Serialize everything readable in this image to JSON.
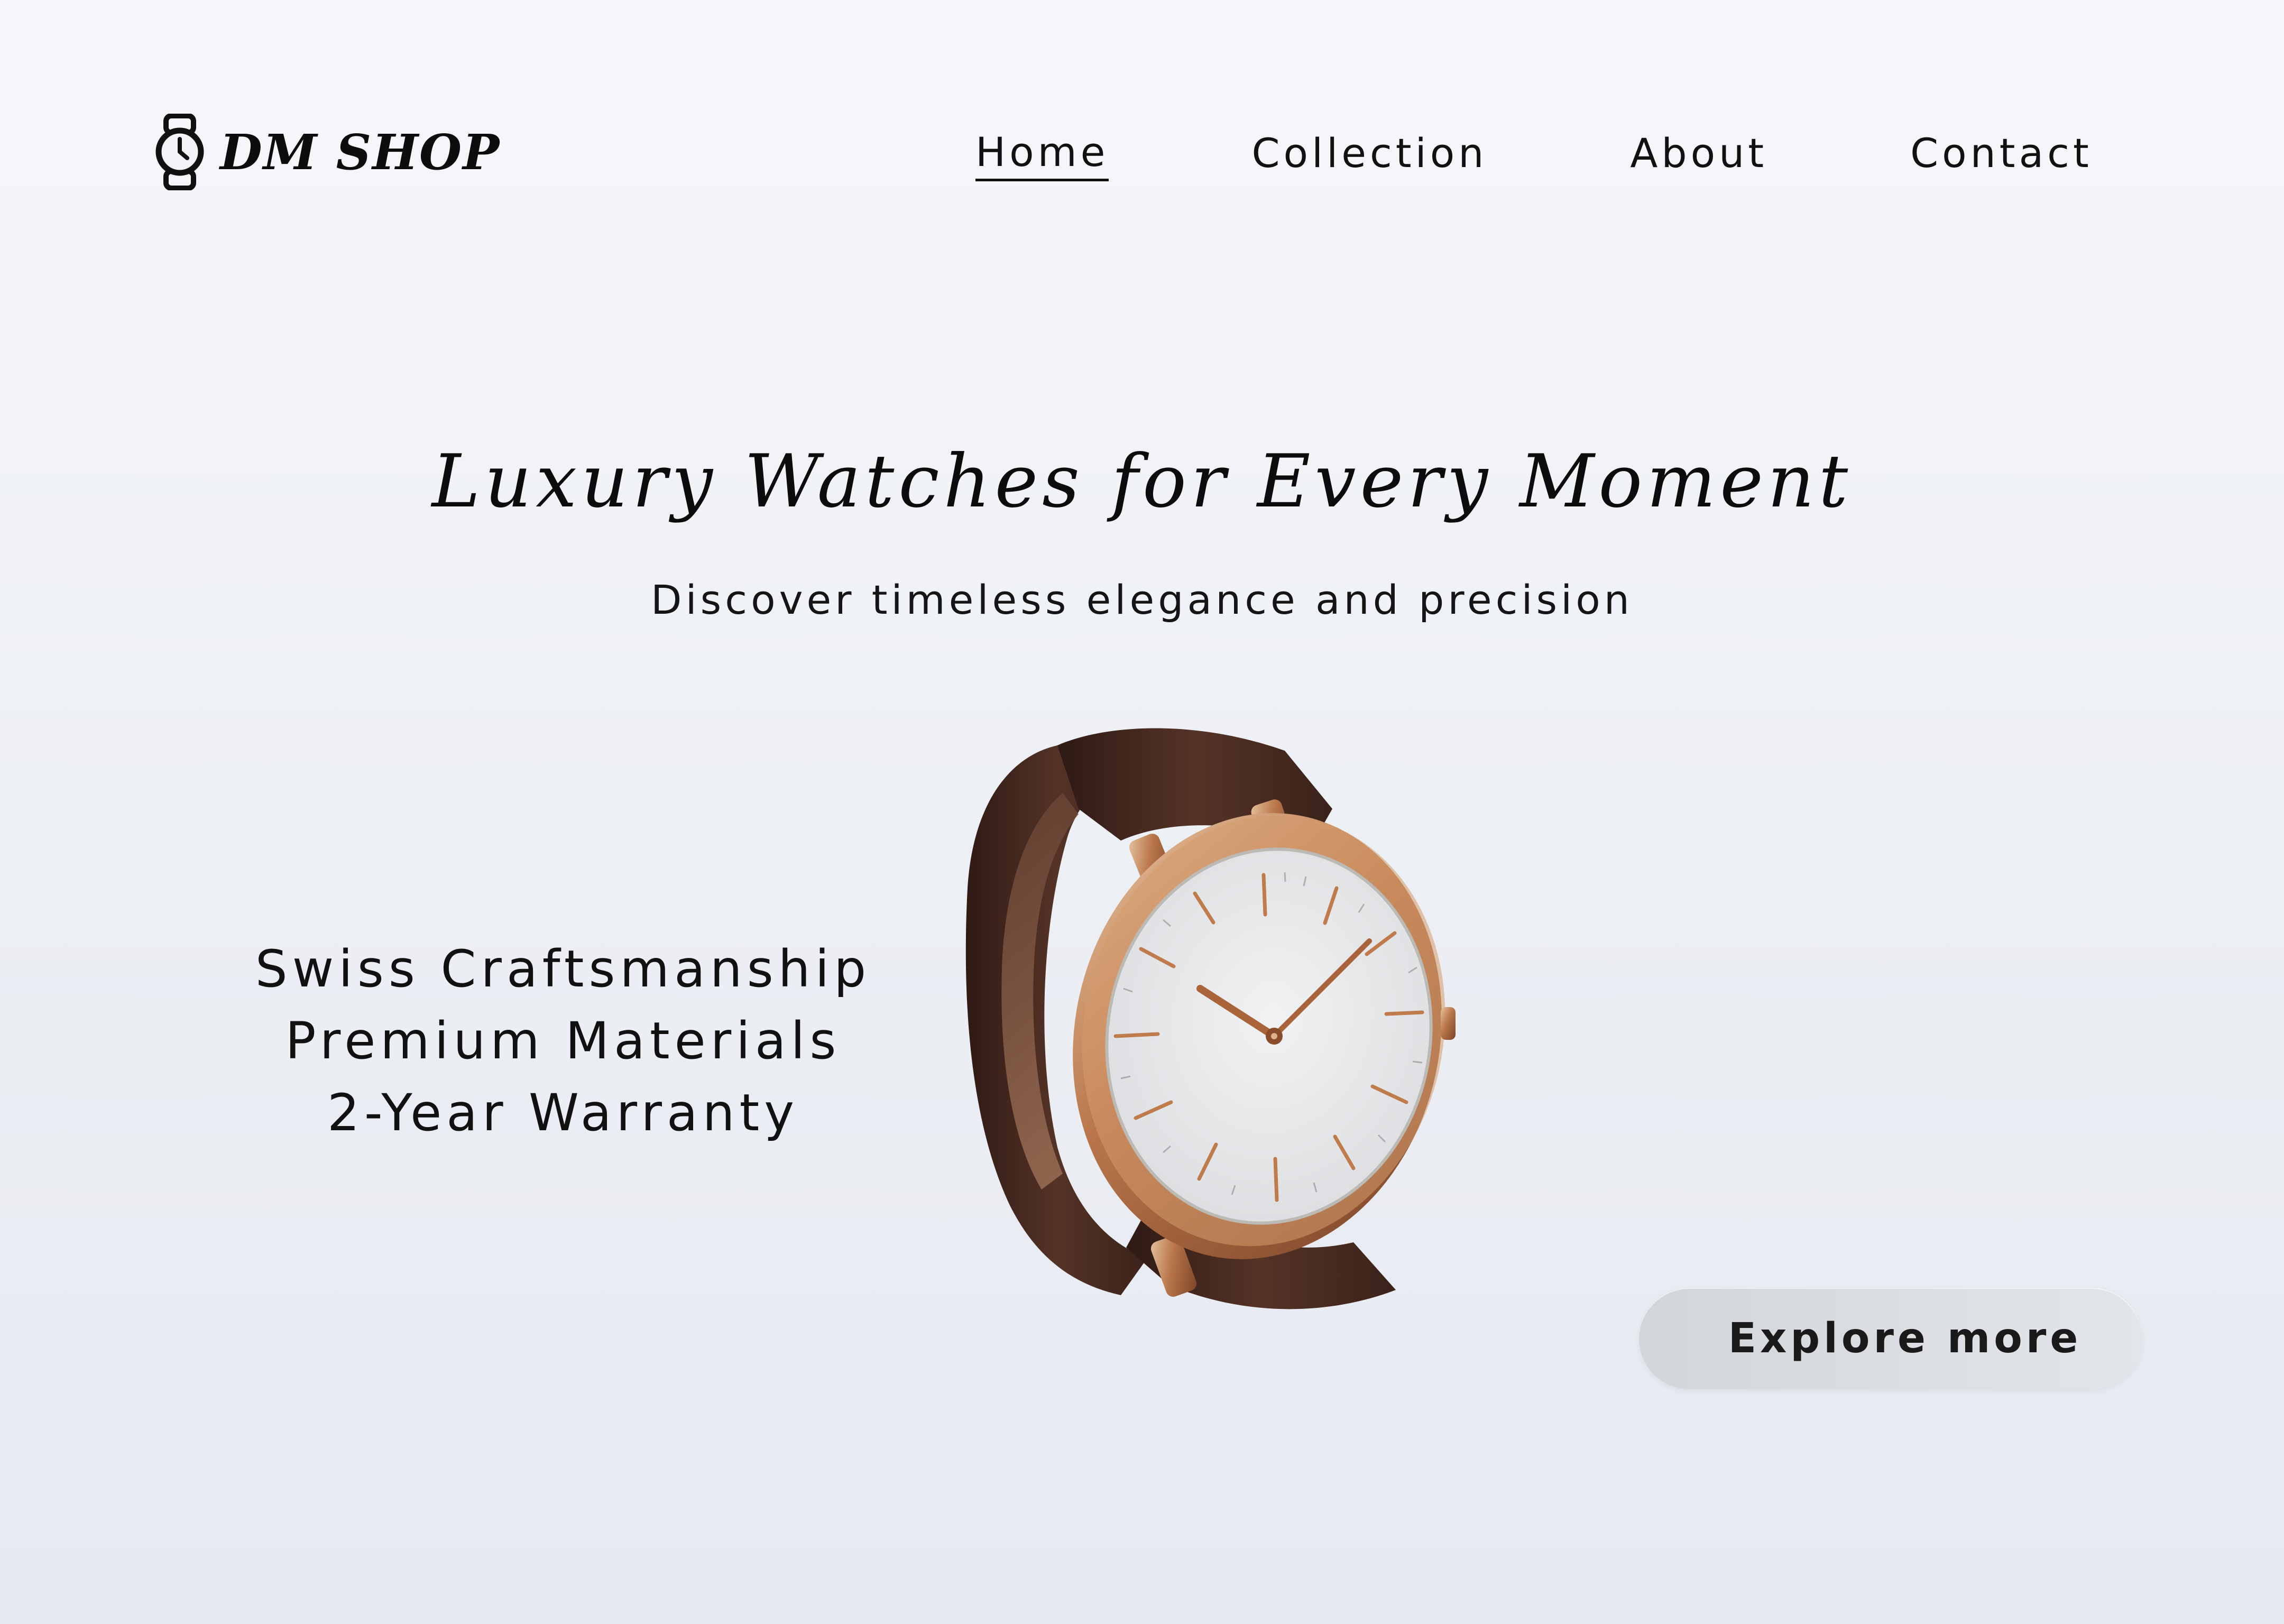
{
  "header": {
    "brand_name": "DM SHOP",
    "brand_icon": "wristwatch-icon",
    "nav": [
      {
        "label": "Home",
        "active": true
      },
      {
        "label": "Collection",
        "active": false
      },
      {
        "label": "About",
        "active": false
      },
      {
        "label": "Contact",
        "active": false
      }
    ]
  },
  "hero": {
    "title": "Luxury Watches for Every Moment",
    "subtitle": "Discover timeless elegance and precision",
    "features": [
      "Swiss Craftsmanship",
      "Premium Materials",
      "2-Year Warranty"
    ],
    "image": "wristwatch-product-photo",
    "cta_label": "Explore more"
  },
  "colors": {
    "background": "#eef0f4",
    "text": "#111111",
    "button": "#d8dbe0",
    "strap": "#4a2c22",
    "case_rose_gold": "#c98a5c",
    "dial": "#eceef0"
  }
}
